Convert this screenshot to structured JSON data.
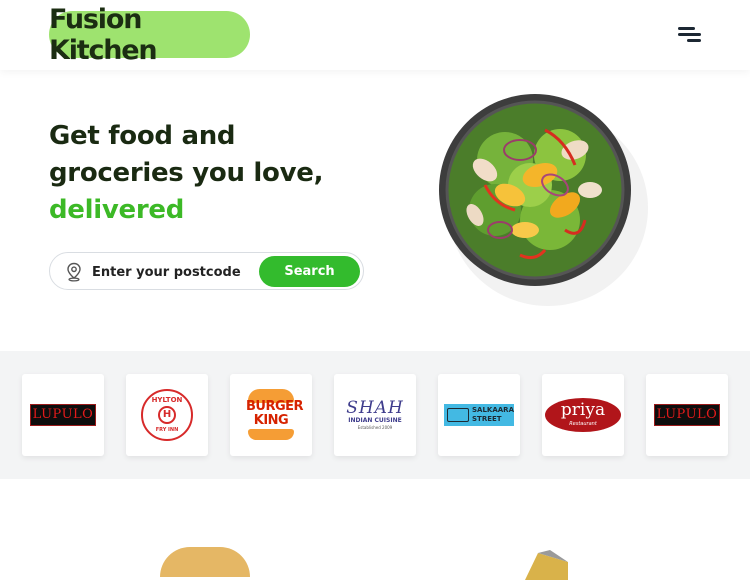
{
  "brand": {
    "name": "Fusion Kitchen",
    "accent_color": "#9ee36f"
  },
  "header": {
    "menu_icon": "hamburger-menu-icon"
  },
  "hero": {
    "title_line1": "Get food and",
    "title_line2": "groceries you love,",
    "title_accent": "delivered",
    "accent_color": "#3cb926"
  },
  "search": {
    "placeholder": "Enter your postcode",
    "value": "",
    "button_label": "Search",
    "icon": "location-pin-icon",
    "button_color": "#33bb2d"
  },
  "restaurants": [
    {
      "name": "Lupulo",
      "logo_text": "LUPULO"
    },
    {
      "name": "Hylton",
      "logo_text": "HYLTON",
      "logo_sub": "FRY INN"
    },
    {
      "name": "Burger King",
      "logo_text1": "BURGER",
      "logo_text2": "KING"
    },
    {
      "name": "Shah",
      "logo_text": "SHAH",
      "logo_sub": "INDIAN CUISINE",
      "logo_sub2": "Established 2009"
    },
    {
      "name": "Salkaara Street",
      "logo_text1": "SALKAARA",
      "logo_text2": "STREET"
    },
    {
      "name": "Priya",
      "logo_text": "priya",
      "logo_sub": "Restaurant"
    },
    {
      "name": "Lupulo",
      "logo_text": "LUPULO"
    }
  ]
}
